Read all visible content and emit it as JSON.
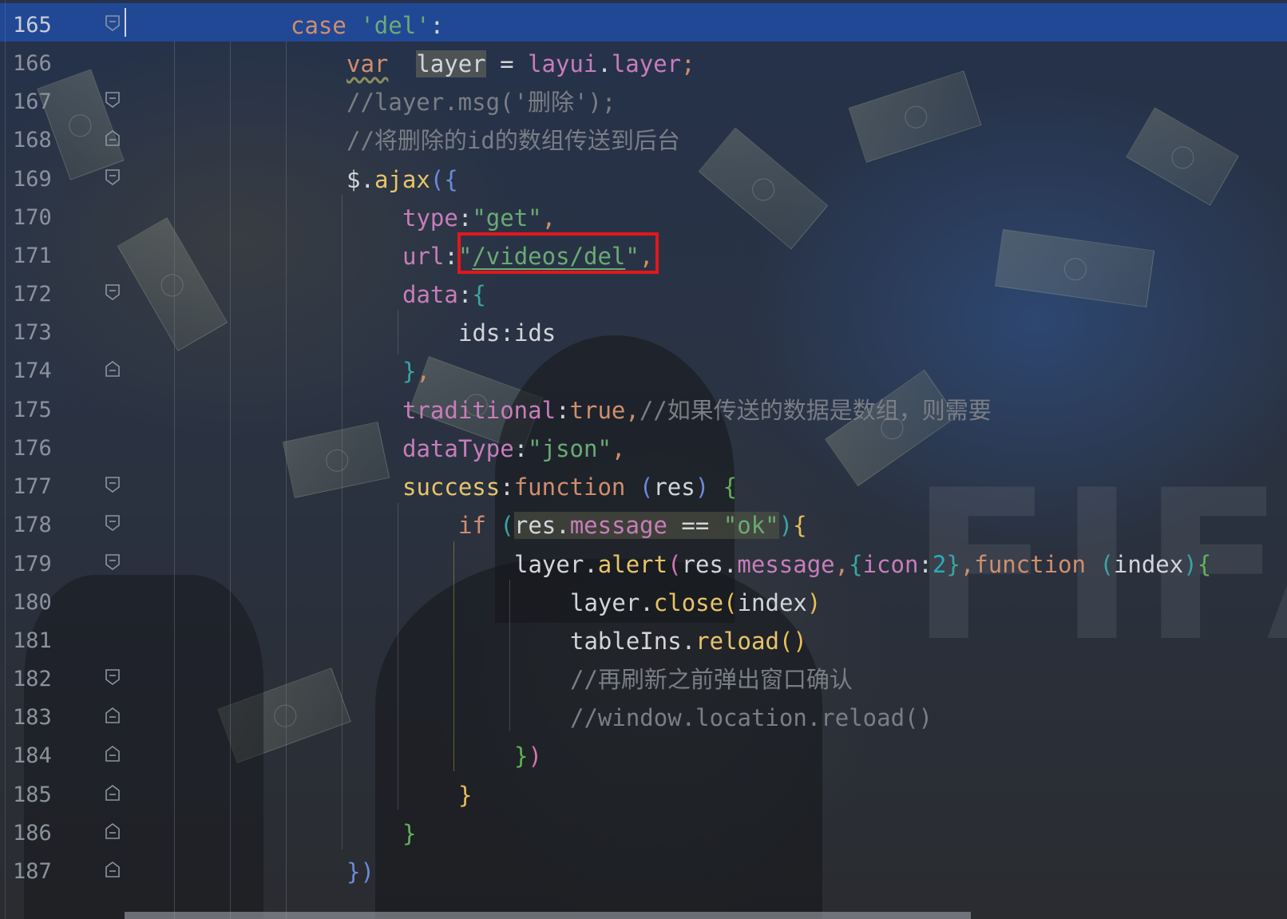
{
  "editor": {
    "current_line": "165",
    "lines": [
      {
        "no": "165",
        "t": [
          "case",
          "'del'",
          ":"
        ]
      },
      {
        "no": "166",
        "t": [
          "var",
          "layer",
          "=",
          "layui",
          ".",
          "layer",
          ";"
        ]
      },
      {
        "no": "167",
        "t": [
          "//layer.msg('删除');"
        ]
      },
      {
        "no": "168",
        "t": [
          "//将删除的id的数组传送到后台"
        ]
      },
      {
        "no": "169",
        "t": [
          "$",
          ".",
          "ajax",
          "(",
          "{"
        ]
      },
      {
        "no": "170",
        "t": [
          "type",
          ":",
          "\"get\"",
          ","
        ]
      },
      {
        "no": "171",
        "t": [
          "url",
          ":",
          "\"",
          "/videos/del",
          "\"",
          ","
        ]
      },
      {
        "no": "172",
        "t": [
          "data",
          ":",
          "{"
        ]
      },
      {
        "no": "173",
        "t": [
          "ids",
          ":",
          "ids"
        ]
      },
      {
        "no": "174",
        "t": [
          "}",
          ","
        ]
      },
      {
        "no": "175",
        "t": [
          "traditional",
          ":",
          "true",
          ",",
          "//如果传送的数据是数组，则需要"
        ]
      },
      {
        "no": "176",
        "t": [
          "dataType",
          ":",
          "\"json\"",
          ","
        ]
      },
      {
        "no": "177",
        "t": [
          "success",
          ":",
          "function",
          "(",
          "res",
          ")",
          "{"
        ]
      },
      {
        "no": "178",
        "t": [
          "if",
          "(",
          "res",
          ".",
          "message",
          "==",
          "\"ok\"",
          ")",
          "{"
        ]
      },
      {
        "no": "179",
        "t": [
          "layer",
          ".",
          "alert",
          "(",
          "res",
          ".",
          "message",
          ",",
          "{",
          "icon",
          ":",
          "2",
          "}",
          ",",
          "function",
          "(",
          "index",
          ")",
          "{"
        ]
      },
      {
        "no": "180",
        "t": [
          "layer",
          ".",
          "close",
          "(",
          "index",
          ")"
        ]
      },
      {
        "no": "181",
        "t": [
          "tableIns",
          ".",
          "reload",
          "()"
        ]
      },
      {
        "no": "182",
        "t": [
          "//再刷新之前弹出窗口确认"
        ]
      },
      {
        "no": "183",
        "t": [
          "//window.location.reload()"
        ]
      },
      {
        "no": "184",
        "t": [
          "}",
          ")"
        ]
      },
      {
        "no": "185",
        "t": [
          "}"
        ]
      },
      {
        "no": "186",
        "t": [
          "}"
        ]
      },
      {
        "no": "187",
        "t": [
          "}",
          ")"
        ]
      }
    ]
  },
  "background": {
    "watermark_text": "FIFA"
  },
  "colors": {
    "caret_line": "#214a9b",
    "highlight_box": "#e3171b",
    "keyword": "#cf8e6d",
    "string": "#6aab73",
    "property": "#c77dbb",
    "comment": "#7a7e85"
  }
}
